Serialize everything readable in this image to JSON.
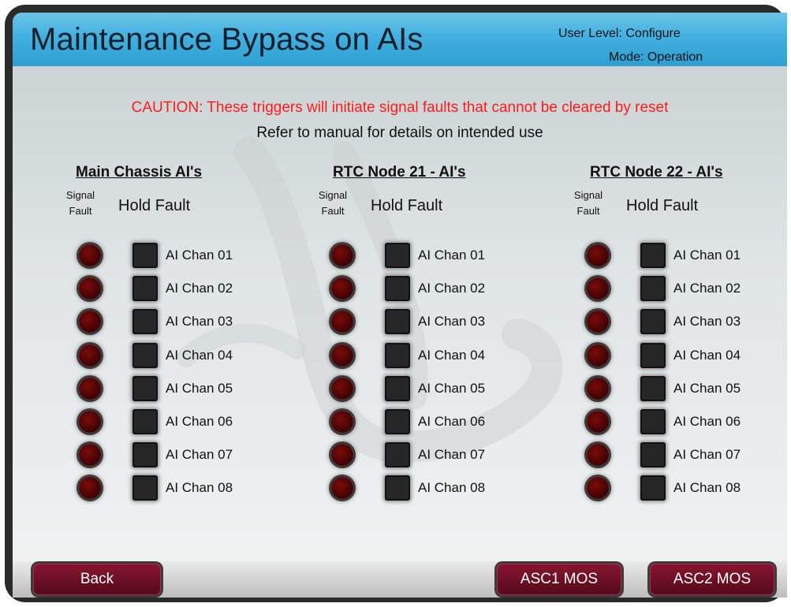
{
  "header": {
    "title": "Maintenance Bypass on AIs",
    "user_level": "User Level: Configure",
    "mode": "Mode: Operation"
  },
  "messages": {
    "caution": "CAUTION: These triggers will initiate signal faults that cannot be cleared by reset",
    "refer": "Refer to manual for details on intended use"
  },
  "column_headers": {
    "signal_fault": "Signal Fault",
    "hold_fault": "Hold Fault"
  },
  "columns": [
    {
      "title": "Main Chassis AI's",
      "channels": [
        {
          "label": "AI Chan 01",
          "signal_fault": "off",
          "hold_fault": "off"
        },
        {
          "label": "AI Chan 02",
          "signal_fault": "off",
          "hold_fault": "off"
        },
        {
          "label": "AI Chan 03",
          "signal_fault": "off",
          "hold_fault": "off"
        },
        {
          "label": "AI Chan 04",
          "signal_fault": "off",
          "hold_fault": "off"
        },
        {
          "label": "AI Chan 05",
          "signal_fault": "off",
          "hold_fault": "off"
        },
        {
          "label": "AI Chan 06",
          "signal_fault": "off",
          "hold_fault": "off"
        },
        {
          "label": "AI Chan 07",
          "signal_fault": "off",
          "hold_fault": "off"
        },
        {
          "label": "AI Chan 08",
          "signal_fault": "off",
          "hold_fault": "off"
        }
      ]
    },
    {
      "title": "RTC Node 21 - AI's",
      "channels": [
        {
          "label": "AI Chan 01",
          "signal_fault": "off",
          "hold_fault": "off"
        },
        {
          "label": "AI Chan 02",
          "signal_fault": "off",
          "hold_fault": "off"
        },
        {
          "label": "AI Chan 03",
          "signal_fault": "off",
          "hold_fault": "off"
        },
        {
          "label": "AI Chan 04",
          "signal_fault": "off",
          "hold_fault": "off"
        },
        {
          "label": "AI Chan 05",
          "signal_fault": "off",
          "hold_fault": "off"
        },
        {
          "label": "AI Chan 06",
          "signal_fault": "off",
          "hold_fault": "off"
        },
        {
          "label": "AI Chan 07",
          "signal_fault": "off",
          "hold_fault": "off"
        },
        {
          "label": "AI Chan 08",
          "signal_fault": "off",
          "hold_fault": "off"
        }
      ]
    },
    {
      "title": "RTC Node 22 - AI's",
      "channels": [
        {
          "label": "AI Chan 01",
          "signal_fault": "off",
          "hold_fault": "off"
        },
        {
          "label": "AI Chan 02",
          "signal_fault": "off",
          "hold_fault": "off"
        },
        {
          "label": "AI Chan 03",
          "signal_fault": "off",
          "hold_fault": "off"
        },
        {
          "label": "AI Chan 04",
          "signal_fault": "off",
          "hold_fault": "off"
        },
        {
          "label": "AI Chan 05",
          "signal_fault": "off",
          "hold_fault": "off"
        },
        {
          "label": "AI Chan 06",
          "signal_fault": "off",
          "hold_fault": "off"
        },
        {
          "label": "AI Chan 07",
          "signal_fault": "off",
          "hold_fault": "off"
        },
        {
          "label": "AI Chan 08",
          "signal_fault": "off",
          "hold_fault": "off"
        }
      ]
    }
  ],
  "footer": {
    "back_label": "Back",
    "asc1_label": "ASC1 MOS",
    "asc2_label": "ASC2 MOS"
  },
  "colors": {
    "header_blue": "#42b0e0",
    "caution_red": "#ff1a1a",
    "button_maroon": "#6a0f24",
    "led_off": "#4a0404"
  }
}
